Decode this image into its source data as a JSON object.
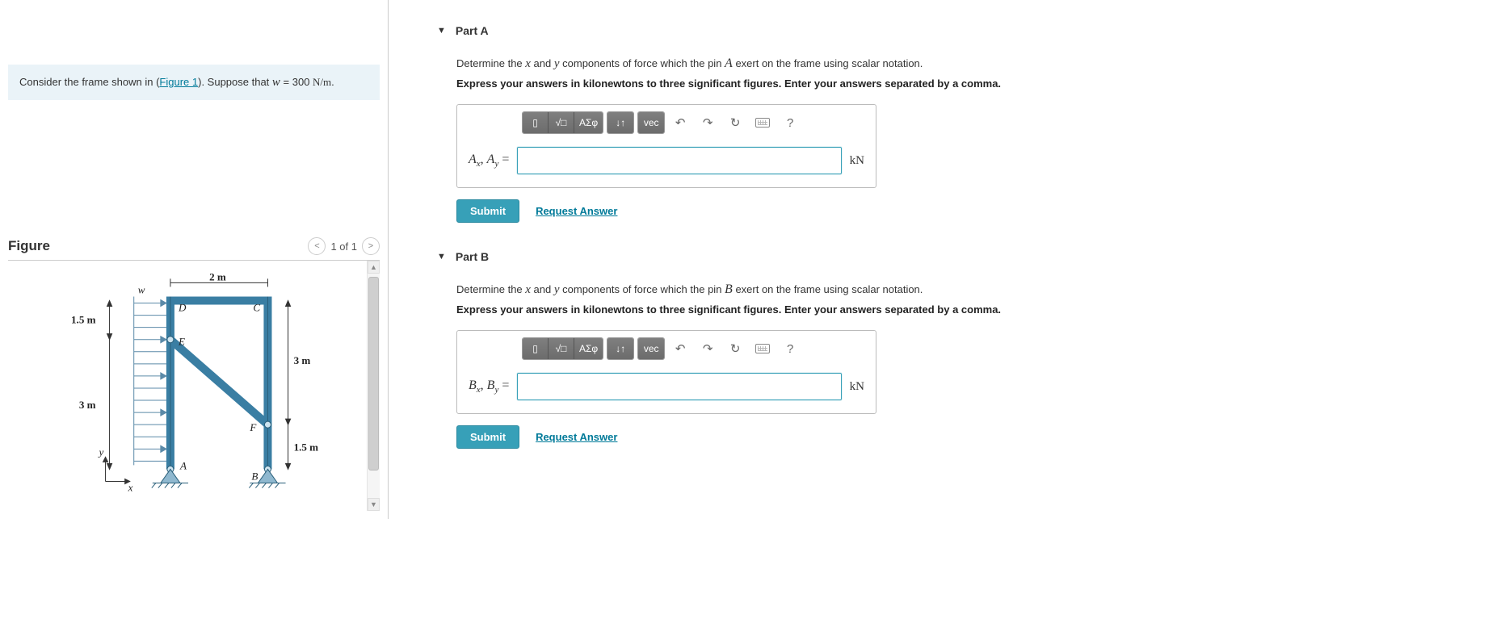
{
  "problem": {
    "prefix": "Consider the frame shown in (",
    "figure_link": "Figure 1",
    "middle": "). Suppose that ",
    "var": "w",
    "equals": " = 300 ",
    "unit_num": "N/m",
    "suffix": "."
  },
  "figure": {
    "title": "Figure",
    "pager": "1 of 1",
    "labels": {
      "w": "w",
      "two_m": "2 m",
      "d": "D",
      "c": "C",
      "e": "E",
      "f": "F",
      "a": "A",
      "b": "B",
      "one_five_m_top": "1.5 m",
      "three_m_right": "3 m",
      "three_m_left": "3 m",
      "one_five_m_bot": "1.5 m",
      "y": "y",
      "x": "x"
    }
  },
  "partA": {
    "title": "Part A",
    "question_pre": "Determine the ",
    "x": "x",
    "and": " and ",
    "y": "y",
    "question_mid": " components of force which the pin ",
    "pin": "A",
    "question_post": " exert on the frame using scalar notation.",
    "instruction": "Express your answers in kilonewtons to three significant figures. Enter your answers separated by a comma.",
    "lhs_a": "A",
    "lhs_sub1": "x",
    "lhs_comma": ", ",
    "lhs_sub2": "y",
    "eq": " =",
    "unit": "kN",
    "submit": "Submit",
    "request": "Request Answer"
  },
  "partB": {
    "title": "Part B",
    "question_pre": "Determine the ",
    "x": "x",
    "and": " and ",
    "y": "y",
    "question_mid": " components of force which the pin ",
    "pin": "B",
    "question_post": " exert on the frame using scalar notation.",
    "instruction": "Express your answers in kilonewtons to three significant figures. Enter your answers separated by a comma.",
    "lhs_b": "B",
    "lhs_sub1": "x",
    "lhs_comma": ", ",
    "lhs_sub2": "y",
    "eq": " =",
    "unit": "kN",
    "submit": "Submit",
    "request": "Request Answer"
  },
  "toolbar": {
    "template": "▯",
    "sqrt": "√□",
    "greek": "ΑΣφ",
    "updown": "↓↑",
    "vec": "vec",
    "undo": "↶",
    "redo": "↷",
    "reset": "↻",
    "help": "?"
  }
}
